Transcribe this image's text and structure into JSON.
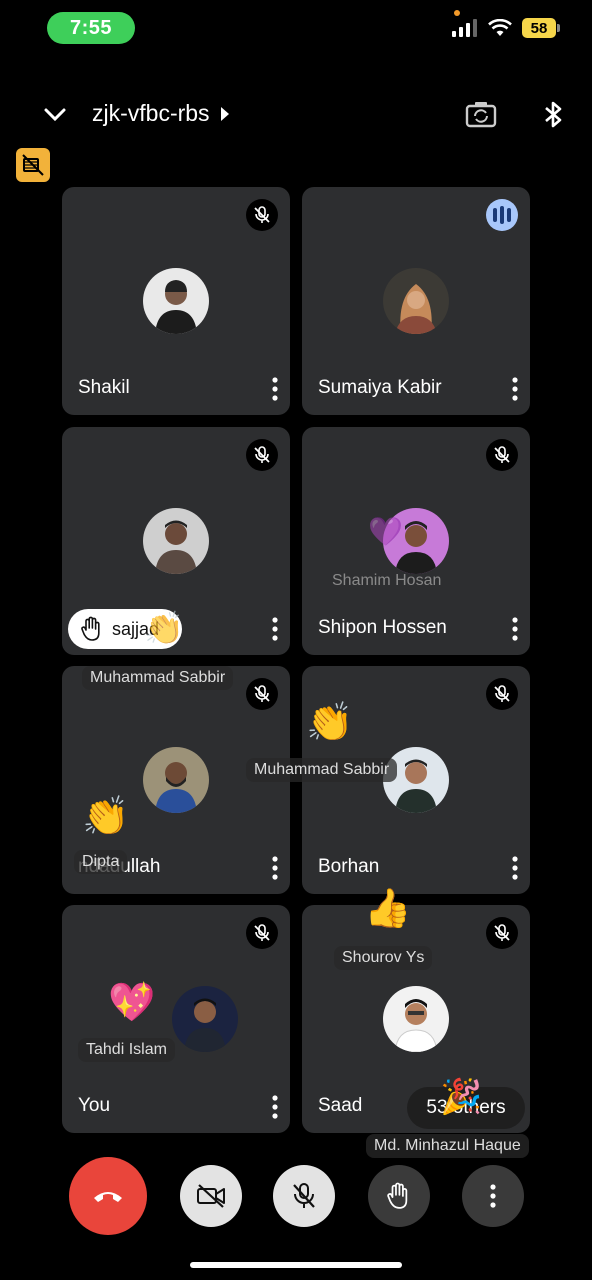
{
  "status_bar": {
    "time": "7:55",
    "battery": "58"
  },
  "header": {
    "meeting_code": "zjk-vfbc-rbs"
  },
  "tiles": [
    {
      "name": "Shakil",
      "state": "muted",
      "avatar_color": "#e9e9e9"
    },
    {
      "name": "Sumaiya Kabir",
      "state": "speaking",
      "avatar_color": "#c58a5a"
    },
    {
      "name": "",
      "state": "muted",
      "avatar_color": "#cfcfcf"
    },
    {
      "name": "Shipon Hossen",
      "state": "muted",
      "avatar_color": "#c77ad8"
    },
    {
      "name": "ndadullah",
      "state": "muted",
      "avatar_color": "#9c9278"
    },
    {
      "name": "Borhan",
      "state": "muted",
      "avatar_color": "#dfe6ec"
    },
    {
      "name": "You",
      "state": "muted",
      "avatar_color": "#1b2340"
    },
    {
      "name": "Saad",
      "state": "muted",
      "avatar_color": "#f2f2f2"
    }
  ],
  "reactions": {
    "shamim": "Shamim Hosan",
    "sabbir_1": "Muhammad Sabbir",
    "sabbir_2": "Muhammad Sabbir",
    "dipta": "Dipta",
    "shourov": "Shourov Ys",
    "tahdi": "Tahdi Islam",
    "minhazul": "Md. Minhazul Haque"
  },
  "raised_hand": {
    "name": "sajjad"
  },
  "others_button": {
    "label": "53 others"
  },
  "colors": {
    "end_call": "#e9453b",
    "tile_bg": "#2d2e30",
    "speaking": "#a8c7fa",
    "badge": "#f2b23a"
  }
}
